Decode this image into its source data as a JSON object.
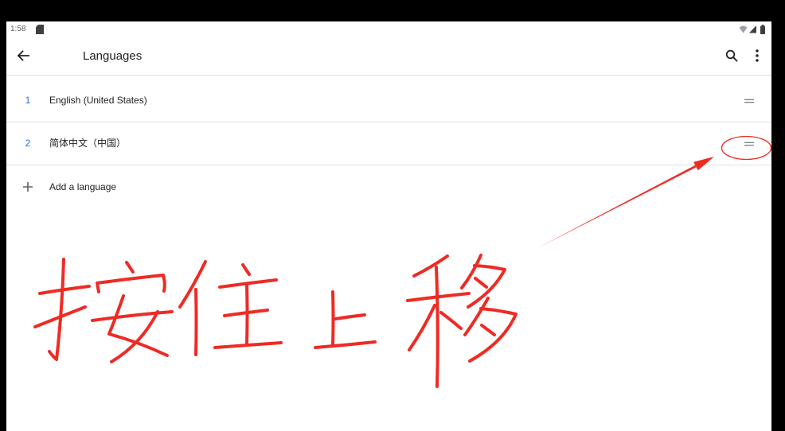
{
  "status_bar": {
    "time": "1:58",
    "left_icons": [
      "sd-card-icon"
    ],
    "right_icons": [
      "wifi-icon",
      "cell-signal-icon",
      "battery-icon"
    ]
  },
  "toolbar": {
    "back_icon": "arrow-back-icon",
    "title": "Languages",
    "actions": [
      "search-icon",
      "more-vert-icon"
    ]
  },
  "languages": [
    {
      "index": "1",
      "name": "English (United States)",
      "handle_icon": "drag-handle-icon"
    },
    {
      "index": "2",
      "name": "简体中文（中国）",
      "handle_icon": "drag-handle-icon"
    }
  ],
  "add_language": {
    "icon": "add-icon",
    "label": "Add a language"
  },
  "annotation": {
    "handwritten_text": "按住上移",
    "color": "#ee2b24"
  },
  "colors": {
    "accent": "#1a73e8",
    "text_primary": "#202124",
    "text_secondary": "#5f6368",
    "divider": "#e0e0e0",
    "background": "#ffffff",
    "frame": "#000000"
  }
}
